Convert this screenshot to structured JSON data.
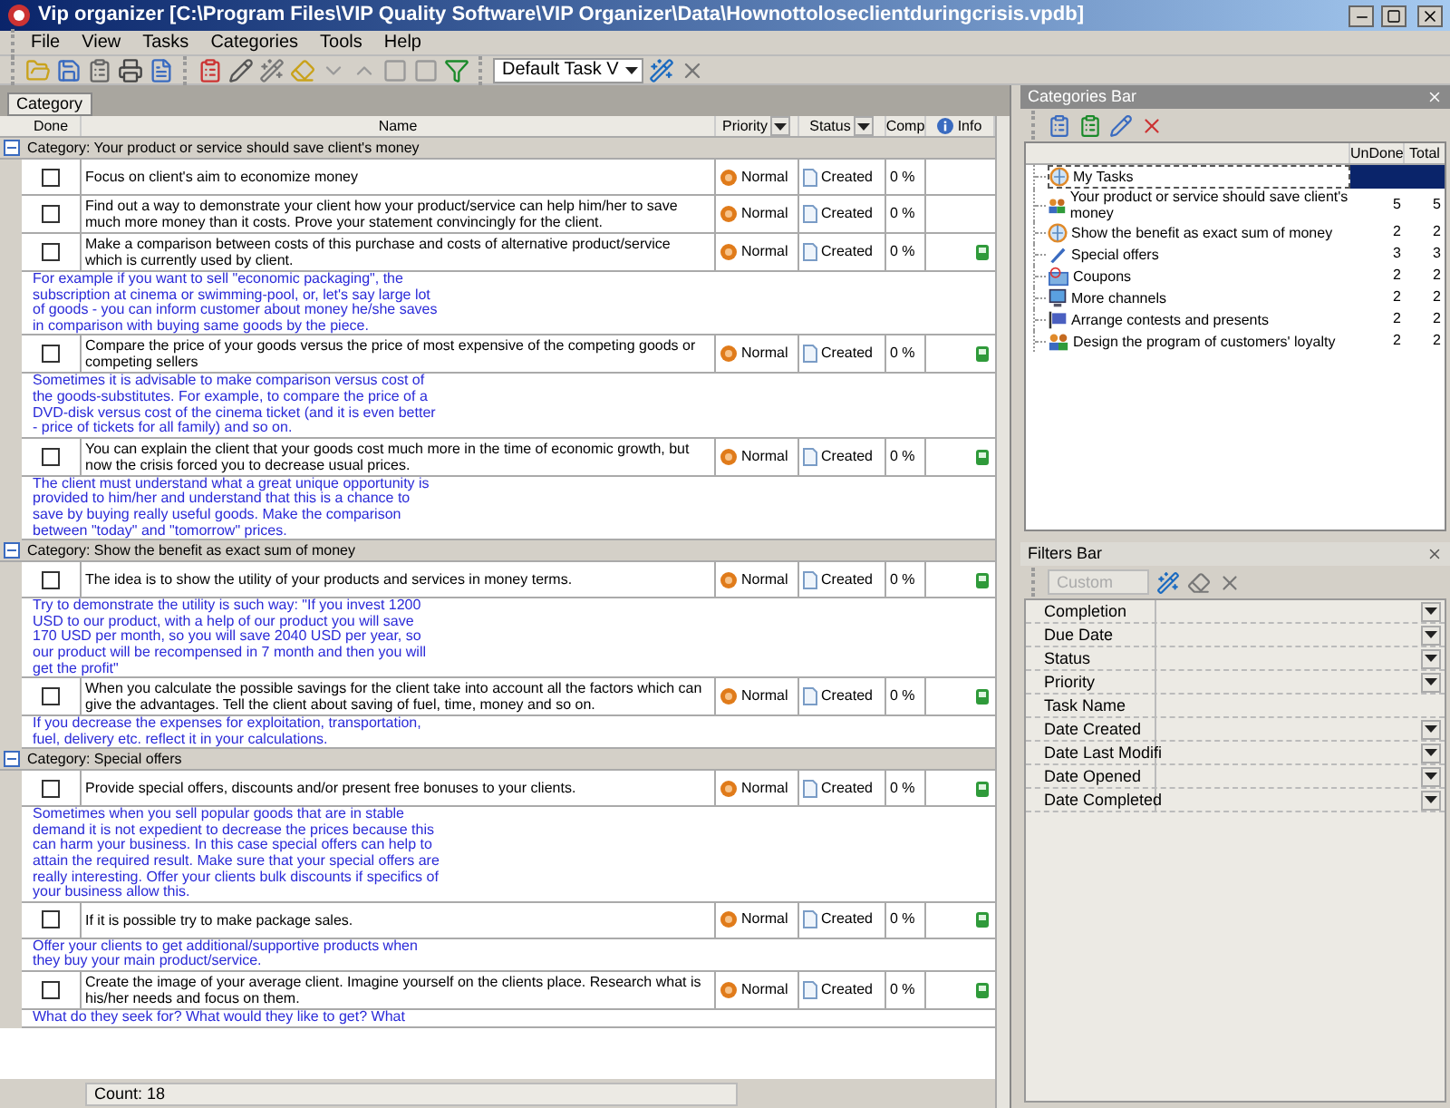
{
  "window": {
    "title": "Vip organizer [C:\\Program Files\\VIP Quality Software\\VIP Organizer\\Data\\Hownottoloseclientduringcrisis.vpdb]"
  },
  "menu": [
    "File",
    "View",
    "Tasks",
    "Categories",
    "Tools",
    "Help"
  ],
  "toolbar": {
    "view_combo": "Default Task V"
  },
  "group_by": {
    "chip": "Category"
  },
  "table": {
    "columns": [
      {
        "label": "Done",
        "filter": false
      },
      {
        "label": "Name",
        "filter": false
      },
      {
        "label": "Priority",
        "filter": true
      },
      {
        "label": "Status",
        "filter": true
      },
      {
        "label": "Comp",
        "filter": false
      },
      {
        "label": "Info",
        "filter": false
      }
    ],
    "groups": [
      {
        "label": "Category: Your product or service should save client's money",
        "expanded": true,
        "tasks": [
          {
            "done": false,
            "name": "Focus on client's aim to economize money",
            "priority": "Normal",
            "status": "Created",
            "completion": "0 %"
          },
          {
            "done": false,
            "name": "Find out a way to demonstrate your client how your product/service can help him/her to save much more money than it costs. Prove your statement convincingly for the client.",
            "priority": "Normal",
            "status": "Created",
            "completion": "0 %"
          },
          {
            "done": false,
            "name": "Make a comparison between costs of this purchase and costs of alternative product/service which is currently used by client.",
            "priority": "Normal",
            "status": "Created",
            "completion": "0 %",
            "note": "For example if you want to sell \"economic packaging\", the subscription at cinema or swimming-pool, or, let's say large lot of goods - you can inform customer about money he/she saves in comparison with buying same goods by the piece."
          },
          {
            "done": false,
            "name": "Compare the price of your goods versus the price of most expensive of the competing goods or competing sellers",
            "priority": "Normal",
            "status": "Created",
            "completion": "0 %",
            "note": "Sometimes it is advisable to make comparison versus cost of the goods-substitutes. For example, to compare the price of a DVD-disk versus cost of the cinema ticket (and it is even better - price of tickets for all family) and so on."
          },
          {
            "done": false,
            "name": "You can explain the client that your goods cost much more in the time of economic growth, but now the crisis forced you to decrease usual prices.",
            "priority": "Normal",
            "status": "Created",
            "completion": "0 %",
            "note": "The client must understand what a great unique opportunity is provided to him/her and understand that this is a chance to save by buying really useful goods. Make the comparison between \"today\" and \"tomorrow\" prices."
          }
        ]
      },
      {
        "label": "Category: Show the benefit as exact sum of money",
        "expanded": true,
        "tasks": [
          {
            "done": false,
            "name": "The idea is to show the utility of your products and services in money terms.",
            "priority": "Normal",
            "status": "Created",
            "completion": "0 %",
            "note": "Try to demonstrate the utility is such way: \"If you invest 1200 USD to our product, with a help of our product you will save 170 USD per month, so you will save 2040 USD per year, so our product will be recompensed in 7 month and then you will get the profit\""
          },
          {
            "done": false,
            "name": "When you calculate the possible savings for the client take into account all the factors which can give the advantages. Tell the client about saving of fuel, time, money and so on.",
            "priority": "Normal",
            "status": "Created",
            "completion": "0 %",
            "note": "If you decrease the expenses for exploitation, transportation, fuel, delivery etc. reflect it in your calculations."
          }
        ]
      },
      {
        "label": "Category: Special offers",
        "expanded": true,
        "tasks": [
          {
            "done": false,
            "name": "Provide special offers, discounts and/or present free bonuses to your clients.",
            "priority": "Normal",
            "status": "Created",
            "completion": "0 %",
            "note": "Sometimes when you sell popular goods that are in stable demand it is not expedient to decrease the prices because this can harm your business. In this case special offers can help to attain the required result. Make sure that your special offers are really interesting. Offer your clients bulk discounts if specifics of your business allow this."
          },
          {
            "done": false,
            "name": "If it is possible try to make package sales.",
            "priority": "Normal",
            "status": "Created",
            "completion": "0 %",
            "note": "Offer your clients to get additional/supportive products when they buy your main product/service."
          },
          {
            "done": false,
            "name": "Create the image of your average client. Imagine yourself on the clients place. Research what is his/her needs and focus on them.",
            "priority": "Normal",
            "status": "Created",
            "completion": "0 %",
            "note": "What do they seek for? What would they like to get? What"
          }
        ]
      }
    ]
  },
  "status_bar": {
    "count": "Count: 18"
  },
  "categories_bar": {
    "title": "Categories Bar",
    "columns": [
      "UnDone",
      "Total"
    ],
    "items": [
      {
        "label": "My Tasks",
        "kind": "globe",
        "selected": true
      },
      {
        "label": "Your product or service should save client's money",
        "kind": "people",
        "selected": false,
        "undone": "5",
        "total": "5"
      },
      {
        "label": "Show the benefit as exact sum of money",
        "kind": "globe",
        "selected": false,
        "undone": "2",
        "total": "2"
      },
      {
        "label": "Special offers",
        "kind": "pen",
        "selected": false,
        "undone": "3",
        "total": "3"
      },
      {
        "label": "Coupons",
        "kind": "coupon",
        "selected": false,
        "undone": "2",
        "total": "2"
      },
      {
        "label": "More channels",
        "kind": "monitor",
        "selected": false,
        "undone": "2",
        "total": "2"
      },
      {
        "label": "Arrange contests and presents",
        "kind": "flag",
        "selected": false,
        "undone": "2",
        "total": "2"
      },
      {
        "label": "Design the program of customers' loyalty",
        "kind": "people",
        "selected": false,
        "undone": "2",
        "total": "2"
      }
    ]
  },
  "filters_bar": {
    "title": "Filters Bar",
    "preset": {
      "placeholder": "Custom"
    },
    "rows": [
      {
        "label": "Completion",
        "dropdown": true
      },
      {
        "label": "Due Date",
        "dropdown": true
      },
      {
        "label": "Status",
        "dropdown": true
      },
      {
        "label": "Priority",
        "dropdown": true
      },
      {
        "label": "Task Name",
        "dropdown": false
      },
      {
        "label": "Date Created",
        "dropdown": true
      },
      {
        "label": "Date Last Modifi",
        "dropdown": true
      },
      {
        "label": "Date Opened",
        "dropdown": true
      },
      {
        "label": "Date Completed",
        "dropdown": true
      }
    ]
  }
}
